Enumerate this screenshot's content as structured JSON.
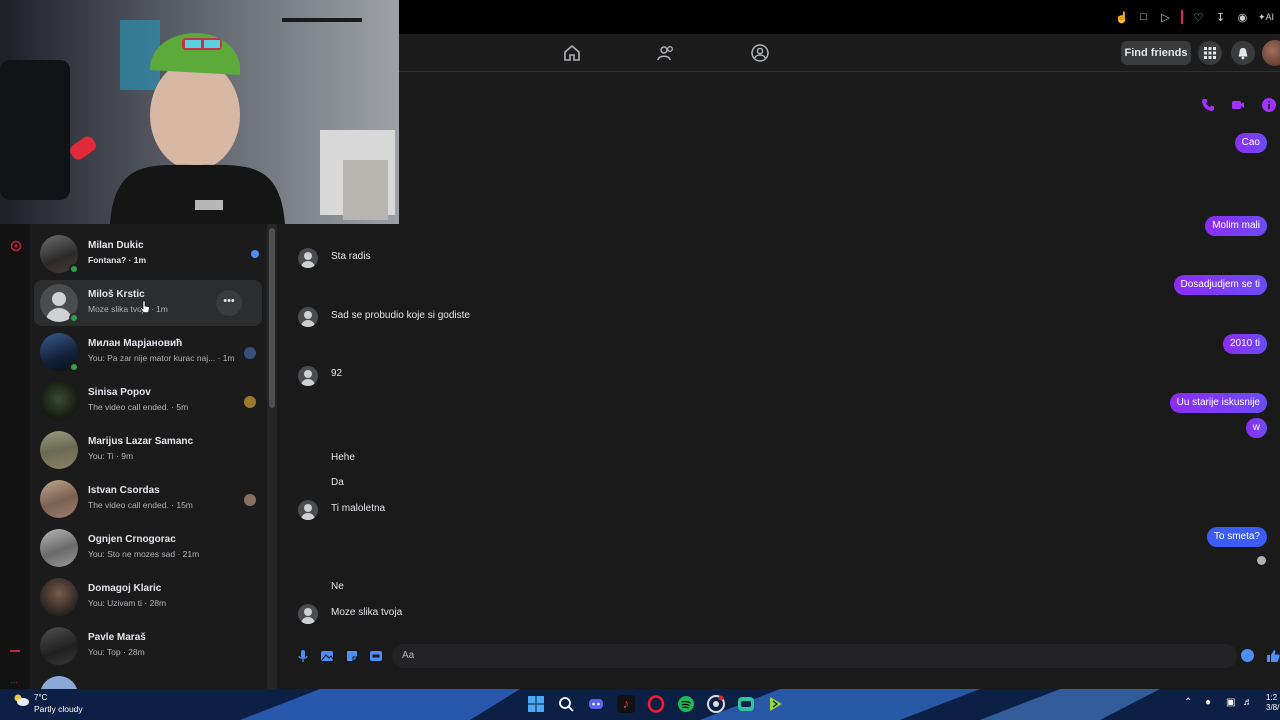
{
  "browser": {
    "icons": [
      "bookmark-icon",
      "window-icon",
      "play-icon",
      "heart-icon",
      "download-icon",
      "account-icon",
      "ai-icon"
    ],
    "ai_label": "AI"
  },
  "nav": {
    "icons": [
      "home-icon",
      "friends-icon",
      "groups-icon"
    ],
    "find_friends": "Find friends",
    "accent": "#0866ff"
  },
  "conversations": [
    {
      "name": "Milan Dukic",
      "preview": "Fontana? · 1m",
      "online": true,
      "unread": true
    },
    {
      "name": "Miloš Krstic",
      "preview": "Moze slika tvoja · 1m",
      "online": true,
      "active": true
    },
    {
      "name": "Милан Марјановић",
      "preview": "You: Pa zar nije mator kurac naj... · 1m",
      "online": true
    },
    {
      "name": "Sinisa Popov",
      "preview": "The video call ended. · 5m"
    },
    {
      "name": "Marijus Lazar Samanc",
      "preview": "You: Ti · 9m"
    },
    {
      "name": "Istvan Csordas",
      "preview": "The video call ended. · 15m"
    },
    {
      "name": "Ognjen Crnogorac",
      "preview": "You: Sto ne mozes sad · 21m"
    },
    {
      "name": "Domagoj Klaric",
      "preview": "You: Uzivam ti · 28m"
    },
    {
      "name": "Pavle Maraš",
      "preview": "You: Top · 28m"
    }
  ],
  "messages": {
    "outgoing": [
      "Cao",
      "Molim mali",
      "Dosadjudjem se ti",
      "2010 ti",
      "Uu starije iskusnije",
      "w",
      "To smeta?"
    ],
    "incoming": [
      "Sta radis",
      "Sad se probudio koje si godiste",
      "92",
      "Hehe",
      "Da",
      "Ti maloletna",
      "Ne",
      "Moze slika tvoja"
    ],
    "out_color": "#8c2cf5",
    "out_color_last": "#3b5cf5"
  },
  "chat_header_icons": [
    "phone-icon",
    "video-icon",
    "info-icon"
  ],
  "composer": {
    "placeholder": "Aa",
    "icons": [
      "microphone-icon",
      "photo-icon",
      "sticker-icon",
      "gif-icon"
    ]
  },
  "taskbar": {
    "temperature": "7°C",
    "weather": "Partly cloudy",
    "apps": [
      "start-icon",
      "search-icon",
      "discord-icon",
      "tiktok-icon",
      "opera-icon",
      "spotify-icon",
      "chrome-icon",
      "chatgpt-icon",
      "terminal-icon"
    ],
    "clock_time": "1:2",
    "clock_date": "3/8/"
  }
}
